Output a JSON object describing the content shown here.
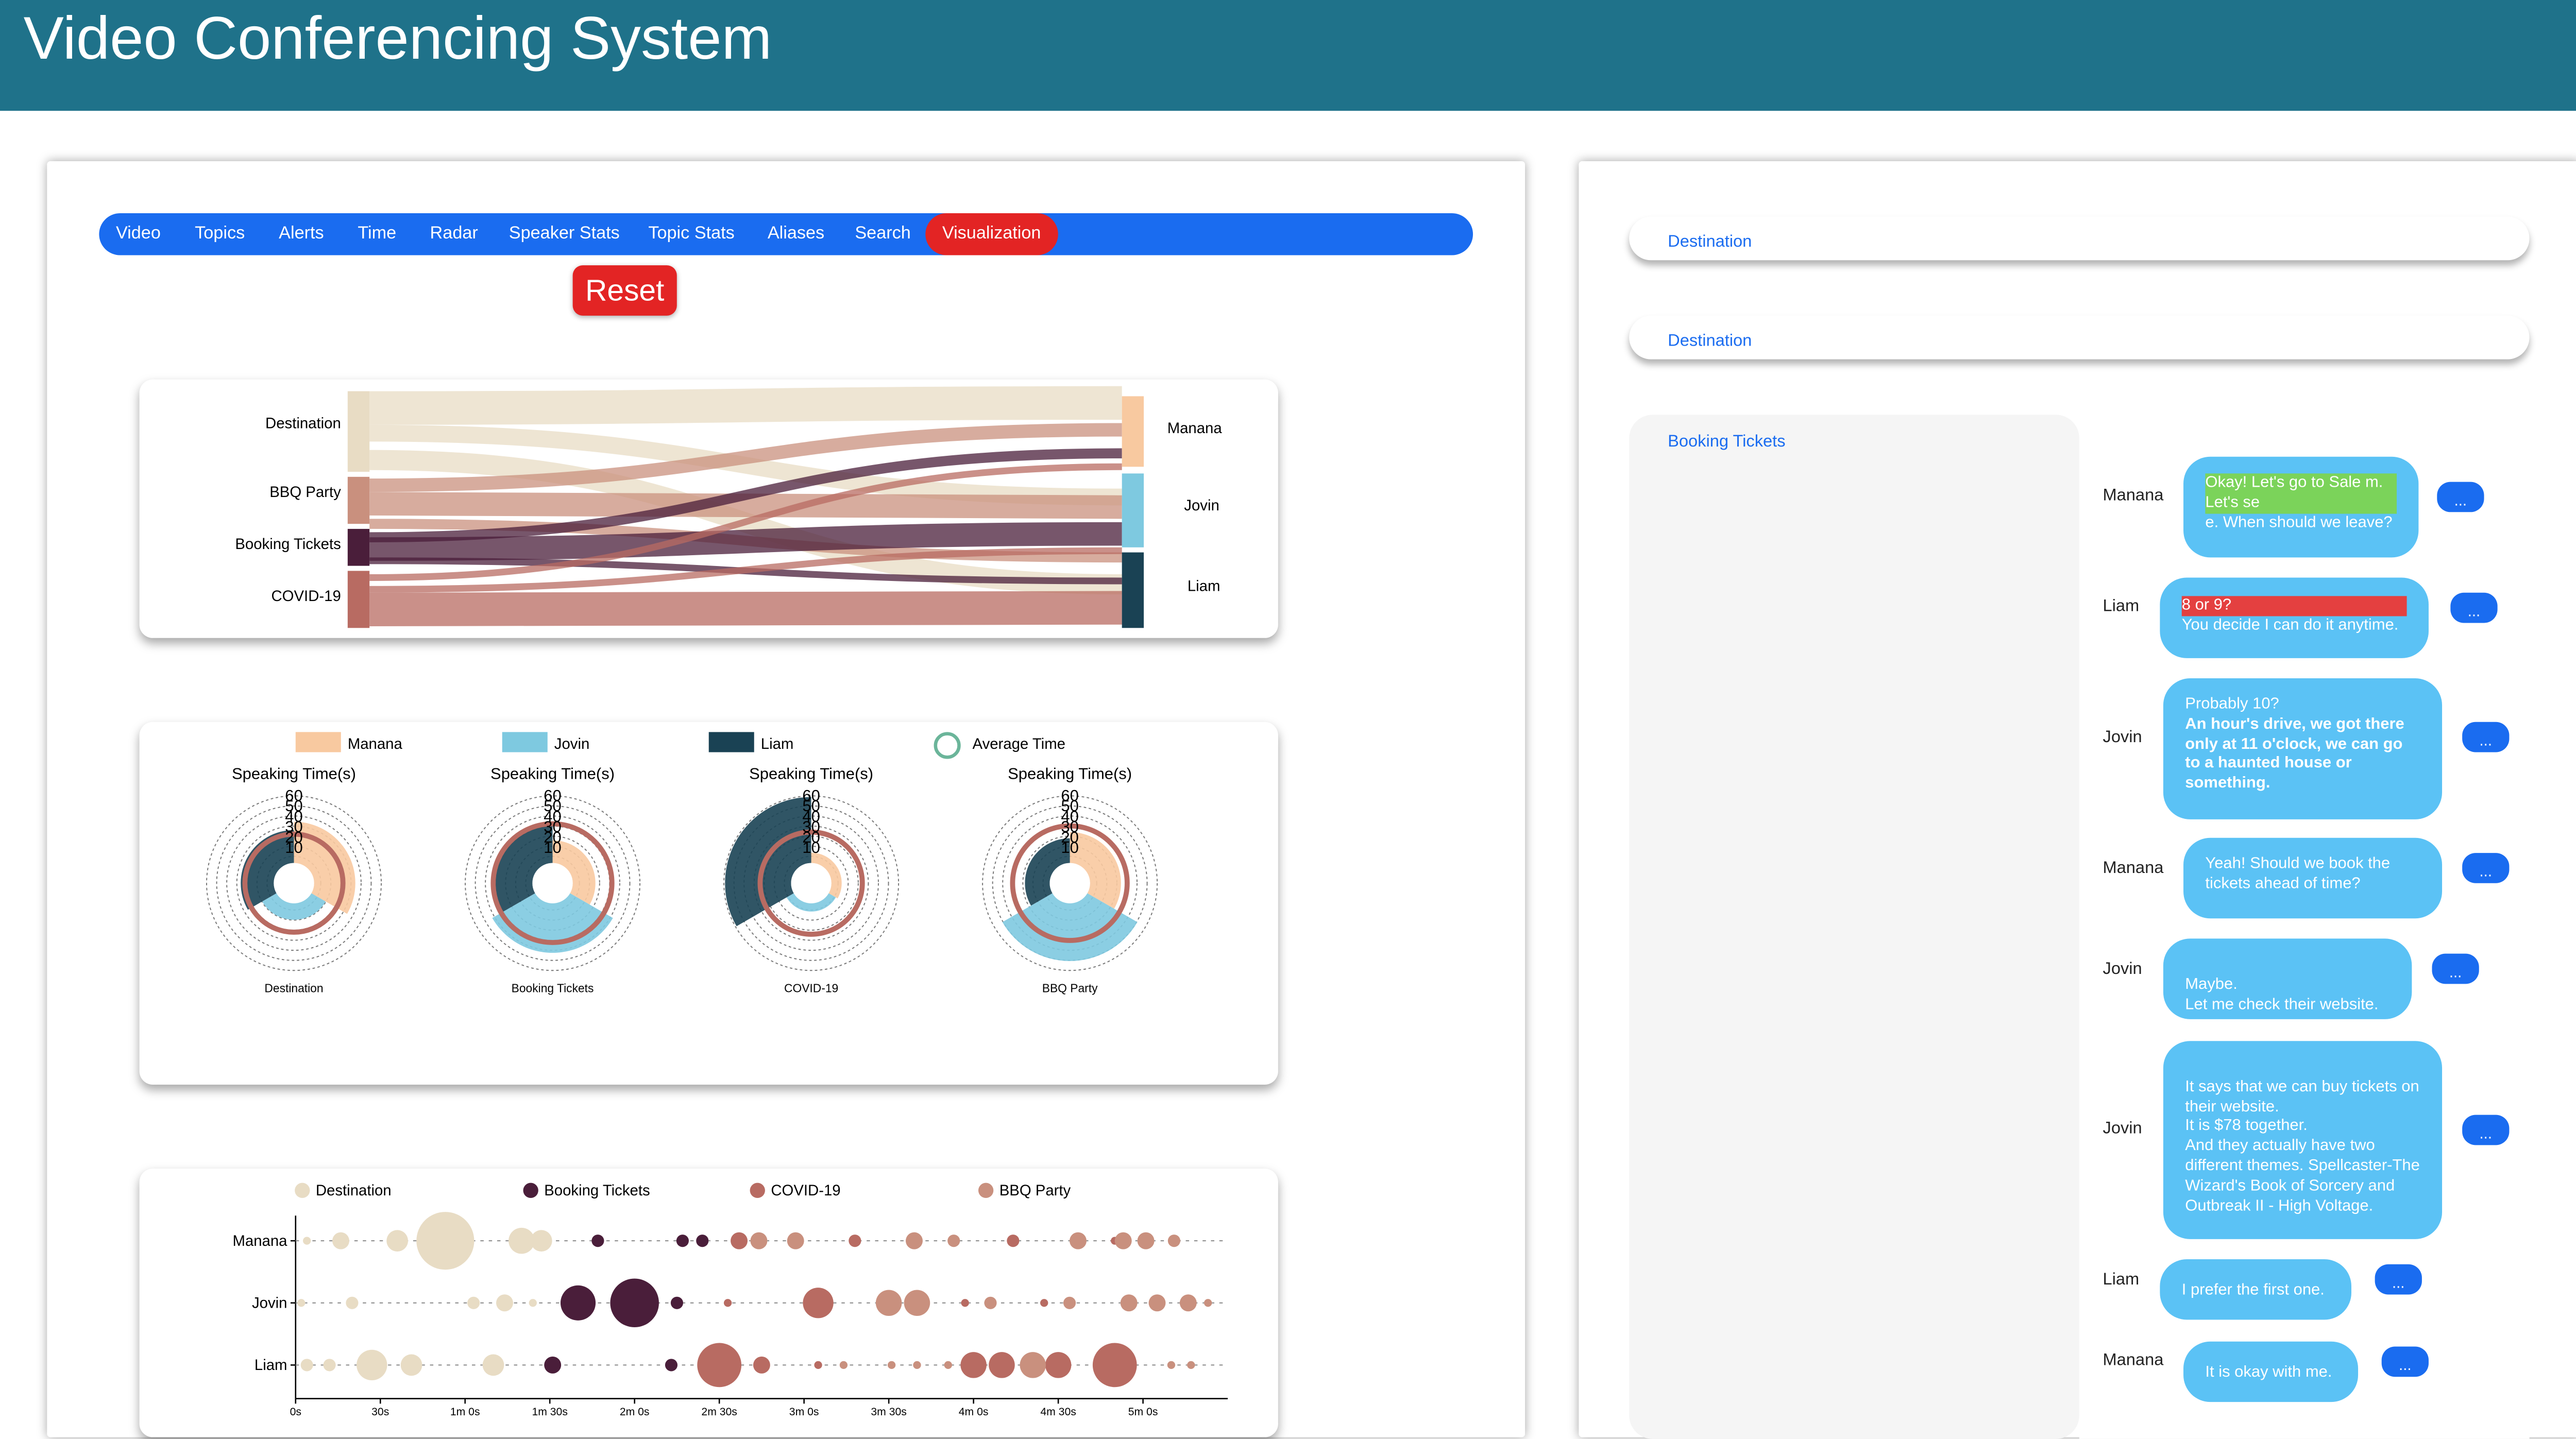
{
  "header": {
    "title": "Video Conferencing System"
  },
  "nav": {
    "items": [
      {
        "label": "Video"
      },
      {
        "label": "Topics"
      },
      {
        "label": "Alerts"
      },
      {
        "label": "Time"
      },
      {
        "label": "Radar"
      },
      {
        "label": "Speaker Stats"
      },
      {
        "label": "Topic Stats"
      },
      {
        "label": "Aliases"
      },
      {
        "label": "Search"
      },
      {
        "label": "Visualization"
      }
    ],
    "active": "Visualization",
    "reset_label": "Reset"
  },
  "colors": {
    "header": "#1f728a",
    "nav": "#1a6cf0",
    "active": "#e32424",
    "manana": "#f8c9a0",
    "jovin": "#7ec9e0",
    "liam": "#1a4254",
    "destination": "#e8dcc4",
    "booking_tickets": "#4a1e3a",
    "covid": "#b86b62",
    "bbq_party": "#c9907e",
    "bubble": "#5bc2f5"
  },
  "sankey": {
    "topics": [
      "Destination",
      "BBQ Party",
      "Booking Tickets",
      "COVID-19"
    ],
    "speakers": [
      "Manana",
      "Jovin",
      "Liam"
    ]
  },
  "radial": {
    "legend": [
      "Manana",
      "Jovin",
      "Liam",
      "Average Time"
    ],
    "title": "Speaking Time(s)",
    "ticks": [
      "60",
      "50",
      "40",
      "30",
      "20",
      "10"
    ],
    "charts": [
      {
        "topic": "Destination",
        "manana": 40,
        "jovin": 16,
        "liam": 32,
        "avg": 28
      },
      {
        "topic": "Booking Tickets",
        "manana": 22,
        "jovin": 48,
        "liam": 40,
        "avg": 38
      },
      {
        "topic": "COVID-19",
        "manana": 10,
        "jovin": 8,
        "liam": 64,
        "avg": 30
      },
      {
        "topic": "BBQ Party",
        "manana": 30,
        "jovin": 56,
        "liam": 24,
        "avg": 36
      }
    ]
  },
  "bubble_chart": {
    "legend": [
      "Destination",
      "Booking Tickets",
      "COVID-19",
      "BBQ Party"
    ],
    "speakers": [
      "Manana",
      "Jovin",
      "Liam"
    ],
    "x_ticks": [
      "0s",
      "30s",
      "1m 0s",
      "1m 30s",
      "2m 0s",
      "2m 30s",
      "3m 0s",
      "3m 30s",
      "4m 0s",
      "4m 30s",
      "5m 0s"
    ],
    "x_max": 330
  },
  "chart_data": {
    "type": "scatter",
    "x_unit": "seconds",
    "xlim": [
      0,
      330
    ],
    "categories": [
      "Manana",
      "Jovin",
      "Liam"
    ],
    "series": [
      {
        "name": "Destination",
        "points": [
          {
            "speaker": "Manana",
            "t": 4,
            "size": 1
          },
          {
            "speaker": "Manana",
            "t": 16,
            "size": 3
          },
          {
            "speaker": "Manana",
            "t": 36,
            "size": 4
          },
          {
            "speaker": "Manana",
            "t": 53,
            "size": 12
          },
          {
            "speaker": "Manana",
            "t": 80,
            "size": 5
          },
          {
            "speaker": "Manana",
            "t": 87,
            "size": 4
          },
          {
            "speaker": "Jovin",
            "t": 2,
            "size": 1
          },
          {
            "speaker": "Jovin",
            "t": 20,
            "size": 2
          },
          {
            "speaker": "Jovin",
            "t": 63,
            "size": 2
          },
          {
            "speaker": "Jovin",
            "t": 74,
            "size": 3
          },
          {
            "speaker": "Jovin",
            "t": 84,
            "size": 1
          },
          {
            "speaker": "Liam",
            "t": 4,
            "size": 2
          },
          {
            "speaker": "Liam",
            "t": 12,
            "size": 2
          },
          {
            "speaker": "Liam",
            "t": 27,
            "size": 6
          },
          {
            "speaker": "Liam",
            "t": 41,
            "size": 4
          },
          {
            "speaker": "Liam",
            "t": 70,
            "size": 4
          }
        ]
      },
      {
        "name": "Booking Tickets",
        "points": [
          {
            "speaker": "Manana",
            "t": 107,
            "size": 2
          },
          {
            "speaker": "Manana",
            "t": 137,
            "size": 2
          },
          {
            "speaker": "Manana",
            "t": 144,
            "size": 2
          },
          {
            "speaker": "Jovin",
            "t": 100,
            "size": 7
          },
          {
            "speaker": "Jovin",
            "t": 120,
            "size": 10
          },
          {
            "speaker": "Jovin",
            "t": 135,
            "size": 2
          },
          {
            "speaker": "Liam",
            "t": 91,
            "size": 3
          },
          {
            "speaker": "Liam",
            "t": 133,
            "size": 2
          }
        ]
      },
      {
        "name": "COVID-19",
        "points": [
          {
            "speaker": "Manana",
            "t": 157,
            "size": 3
          },
          {
            "speaker": "Manana",
            "t": 198,
            "size": 2
          },
          {
            "speaker": "Manana",
            "t": 254,
            "size": 2
          },
          {
            "speaker": "Manana",
            "t": 290,
            "size": 1
          },
          {
            "speaker": "Jovin",
            "t": 153,
            "size": 1
          },
          {
            "speaker": "Jovin",
            "t": 185,
            "size": 6
          },
          {
            "speaker": "Jovin",
            "t": 237,
            "size": 1
          },
          {
            "speaker": "Jovin",
            "t": 265,
            "size": 1
          },
          {
            "speaker": "Liam",
            "t": 150,
            "size": 9
          },
          {
            "speaker": "Liam",
            "t": 165,
            "size": 3
          },
          {
            "speaker": "Liam",
            "t": 185,
            "size": 1
          },
          {
            "speaker": "Liam",
            "t": 240,
            "size": 5
          },
          {
            "speaker": "Liam",
            "t": 250,
            "size": 5
          },
          {
            "speaker": "Liam",
            "t": 270,
            "size": 5
          },
          {
            "speaker": "Liam",
            "t": 290,
            "size": 9
          }
        ]
      },
      {
        "name": "BBQ Party",
        "points": [
          {
            "speaker": "Manana",
            "t": 164,
            "size": 3
          },
          {
            "speaker": "Manana",
            "t": 177,
            "size": 3
          },
          {
            "speaker": "Manana",
            "t": 219,
            "size": 3
          },
          {
            "speaker": "Manana",
            "t": 233,
            "size": 2
          },
          {
            "speaker": "Manana",
            "t": 277,
            "size": 3
          },
          {
            "speaker": "Manana",
            "t": 293,
            "size": 3
          },
          {
            "speaker": "Manana",
            "t": 301,
            "size": 3
          },
          {
            "speaker": "Manana",
            "t": 311,
            "size": 2
          },
          {
            "speaker": "Jovin",
            "t": 210,
            "size": 5
          },
          {
            "speaker": "Jovin",
            "t": 220,
            "size": 5
          },
          {
            "speaker": "Jovin",
            "t": 246,
            "size": 2
          },
          {
            "speaker": "Jovin",
            "t": 274,
            "size": 2
          },
          {
            "speaker": "Jovin",
            "t": 295,
            "size": 3
          },
          {
            "speaker": "Jovin",
            "t": 305,
            "size": 3
          },
          {
            "speaker": "Jovin",
            "t": 316,
            "size": 3
          },
          {
            "speaker": "Jovin",
            "t": 323,
            "size": 1
          },
          {
            "speaker": "Liam",
            "t": 194,
            "size": 1
          },
          {
            "speaker": "Liam",
            "t": 211,
            "size": 1
          },
          {
            "speaker": "Liam",
            "t": 220,
            "size": 1
          },
          {
            "speaker": "Liam",
            "t": 231,
            "size": 1
          },
          {
            "speaker": "Liam",
            "t": 261,
            "size": 5
          },
          {
            "speaker": "Liam",
            "t": 310,
            "size": 1
          },
          {
            "speaker": "Liam",
            "t": 317,
            "size": 1
          }
        ]
      }
    ]
  },
  "topic_panel": {
    "cards": [
      "Destination",
      "Destination"
    ],
    "expanded": "Booking Tickets"
  },
  "chat": {
    "more_label": "...",
    "messages": [
      {
        "speaker": "Manana",
        "highlight_green": "Okay! Let's go to Sale m. Let's se",
        "text": "e. When should we leave?"
      },
      {
        "speaker": "Liam",
        "highlight_red": "8 or 9?",
        "text": "You decide I can do it anytime."
      },
      {
        "speaker": "Jovin",
        "text": "Probably 10?",
        "bold": "An hour's drive, we got there only at 11 o'clock, we can go to a haunted house or something."
      },
      {
        "speaker": "Manana",
        "text": "Yeah! Should we book the tickets ahead of time?"
      },
      {
        "speaker": "Jovin",
        "text": "Maybe.\nLet me check their website."
      },
      {
        "speaker": "Jovin",
        "text": "It says that we can buy tickets on their website.\nIt is $78 together.\nAnd they actually have two different themes. Spellcaster-The Wizard's Book of Sorcery and Outbreak II - High Voltage."
      },
      {
        "speaker": "Liam",
        "text": "I prefer the first one."
      },
      {
        "speaker": "Manana",
        "text": "It is okay with me."
      }
    ]
  }
}
